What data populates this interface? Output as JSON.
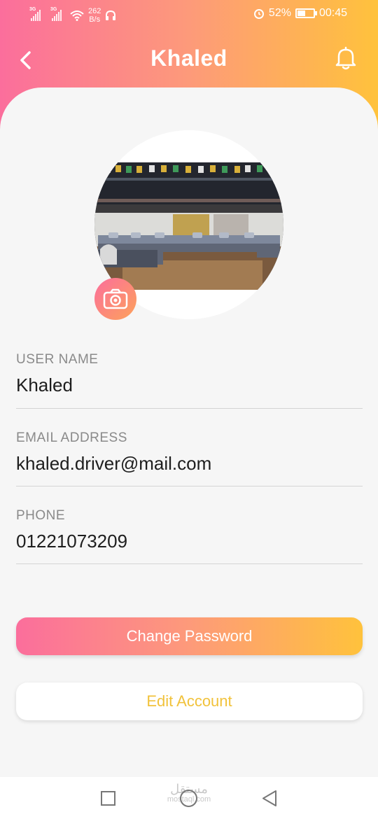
{
  "status_bar": {
    "network_1": "3G",
    "network_2": "3G",
    "speed_value": "262",
    "speed_unit": "B/s",
    "battery_percent": "52%",
    "battery_level": 0.52,
    "time": "00:45"
  },
  "header": {
    "title": "Khaled"
  },
  "profile": {
    "fields": [
      {
        "label": "USER NAME",
        "value": "Khaled"
      },
      {
        "label": "EMAIL ADDRESS",
        "value": "khaled.driver@mail.com"
      },
      {
        "label": "PHONE",
        "value": "01221073209"
      }
    ]
  },
  "actions": {
    "change_password": "Change Password",
    "edit_account": "Edit Account"
  },
  "watermark": {
    "arabic": "مستقل",
    "latin": "mostaql.com"
  },
  "colors": {
    "gradient_start": "#fb6e9c",
    "gradient_end": "#ffc23c",
    "secondary_text": "#f1c23b"
  },
  "icons": [
    "back-arrow-icon",
    "bell-icon",
    "camera-icon",
    "wifi-icon",
    "headphones-icon",
    "alarm-icon",
    "battery-icon"
  ]
}
